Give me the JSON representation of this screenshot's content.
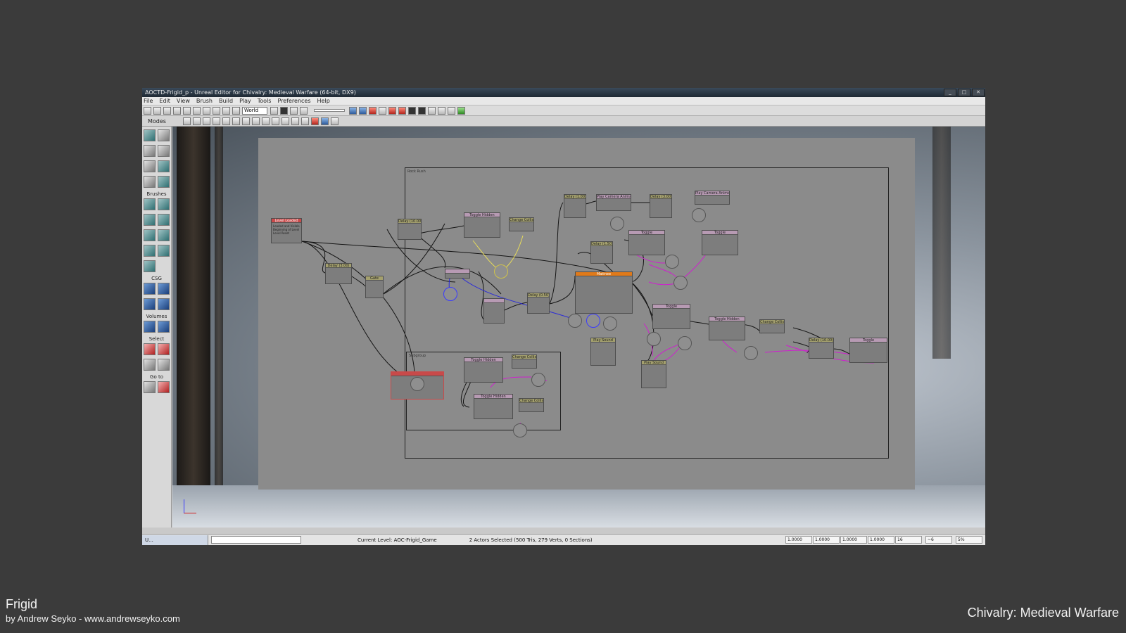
{
  "window": {
    "title": "AOCTD-Frigid_p - Unreal Editor for Chivalry: Medieval Warfare (64-bit, DX9)",
    "controls": [
      "_",
      "□",
      "✕"
    ]
  },
  "menu": [
    "File",
    "Edit",
    "View",
    "Brush",
    "Build",
    "Play",
    "Tools",
    "Preferences",
    "Help"
  ],
  "toolbar": {
    "coord_system": "World"
  },
  "modes_panel": {
    "label": "Modes",
    "sections": [
      "Brushes",
      "CSG",
      "Volumes",
      "Select",
      "Go to"
    ]
  },
  "kismet": {
    "nodes": [
      {
        "id": "level-loaded",
        "title": "Level Loaded",
        "outputs": [
          "Loaded and Visible",
          "Beginning of Level",
          "Level Reset"
        ]
      },
      {
        "id": "delay-1",
        "title": "Delay (10.00)"
      },
      {
        "id": "delay-2",
        "title": "Delay (3.00)"
      },
      {
        "id": "gate",
        "title": "Gate"
      },
      {
        "id": "toggle-hidden-1",
        "title": "Toggle Hidden"
      },
      {
        "id": "change-collision-1",
        "title": "Change Collision"
      },
      {
        "id": "delay-3",
        "title": "Delay (1.00)"
      },
      {
        "id": "play-camera-anim-1",
        "title": "Play Camera Animation"
      },
      {
        "id": "delay-4",
        "title": "Delay (3.00)"
      },
      {
        "id": "play-camera-anim-2",
        "title": "Play Camera Animation"
      },
      {
        "id": "delay-5",
        "title": "Delay (1.50)"
      },
      {
        "id": "toggle-1",
        "title": "Toggle"
      },
      {
        "id": "toggle-2",
        "title": "Toggle"
      },
      {
        "id": "matinee",
        "title": "Matinee"
      },
      {
        "id": "delay-6",
        "title": "Delay (0.50)"
      },
      {
        "id": "play-sound-1",
        "title": "Play Sound"
      },
      {
        "id": "toggle-3",
        "title": "Toggle"
      },
      {
        "id": "toggle-hidden-2",
        "title": "Toggle Hidden"
      },
      {
        "id": "change-collision-2",
        "title": "Change Collision"
      },
      {
        "id": "play-sound-2",
        "title": "Play Sound"
      },
      {
        "id": "delay-7",
        "title": "Delay (10.00)"
      },
      {
        "id": "toggle-4",
        "title": "Toggle"
      },
      {
        "id": "toggle-hidden-3",
        "title": "Toggle Hidden"
      },
      {
        "id": "change-collision-3",
        "title": "Change Collision"
      },
      {
        "id": "toggle-hidden-4",
        "title": "Toggle Hidden"
      },
      {
        "id": "change-collision-4",
        "title": "Change Collision"
      }
    ]
  },
  "statusbar": {
    "tab_label": "U...",
    "current_level": "Current Level:  AOC-Frigid_Game",
    "actors_selected": "2 Actors Selected (500 Tris, 279 Verts, 0 Sections)",
    "scale_values": [
      "1.0000",
      "1.0000",
      "1.0000",
      "1.0000"
    ],
    "grid": "16",
    "rot_snap": "~6",
    "scale_snap": "5%"
  },
  "captions": {
    "map_name": "Frigid",
    "author": "by Andrew Seyko - www.andrewseyko.com",
    "game": "Chivalry: Medieval Warfare"
  }
}
